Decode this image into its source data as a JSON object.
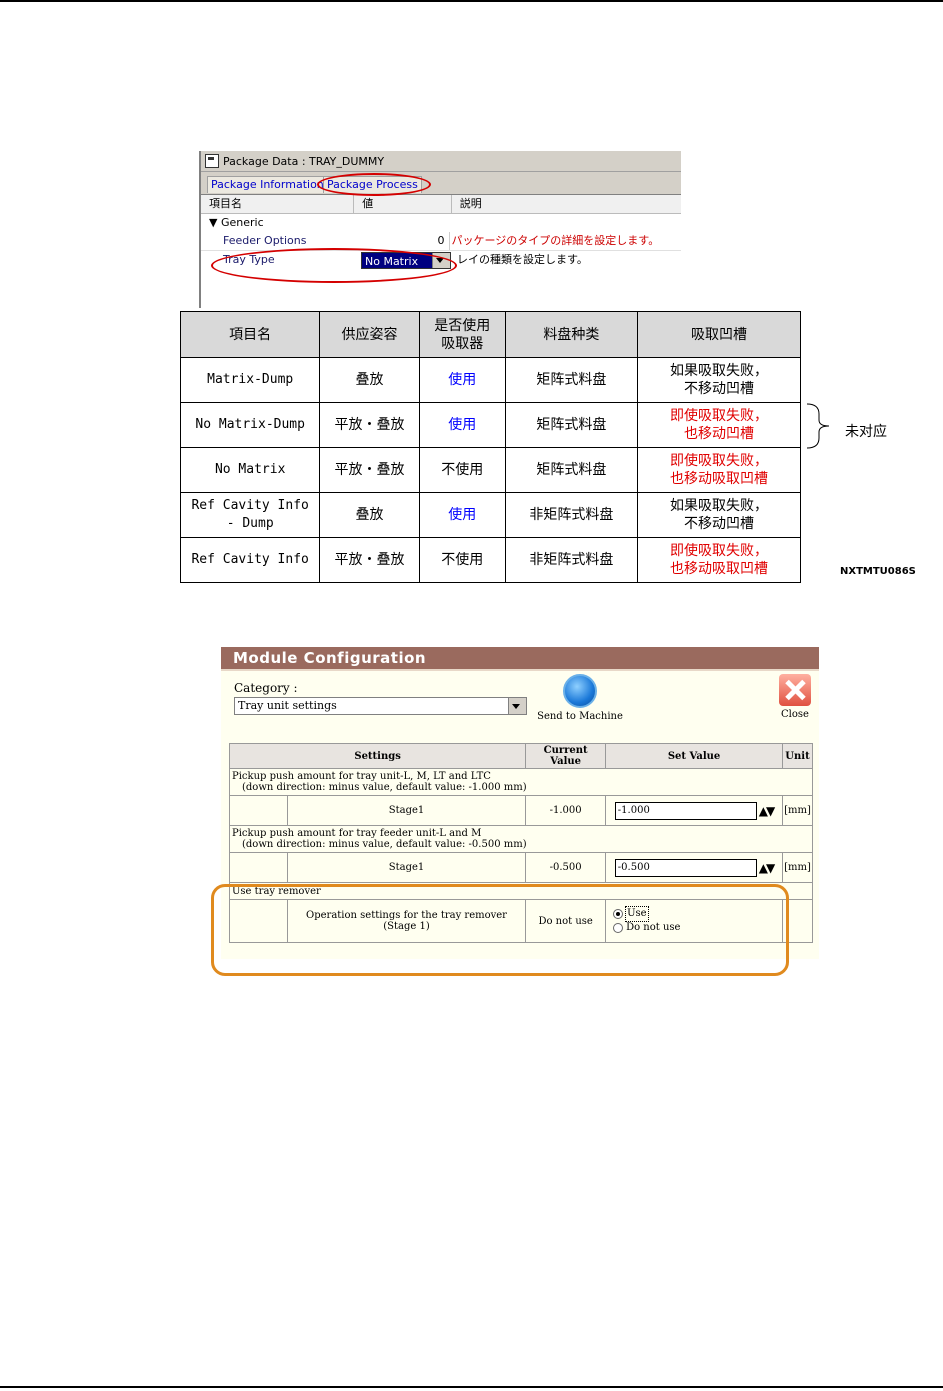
{
  "package_window": {
    "title": "Package Data : TRAY_DUMMY",
    "tabs": [
      "Package Information",
      "Package Process"
    ],
    "columns": [
      "項目名",
      "値",
      "説明"
    ],
    "group": "▼ Generic",
    "rows": [
      {
        "name": "Feeder Options",
        "value": "0",
        "desc": "パッケージのタイプの詳細を設定します。"
      },
      {
        "name": "Tray Type",
        "value": "No Matrix",
        "desc": "レイの種類を設定します。"
      }
    ]
  },
  "cn_table": {
    "headers": [
      "項目名",
      "供应姿容",
      "是否使用\n吸取器",
      "料盘种类",
      "吸取凹槽"
    ],
    "rows": [
      {
        "name": "Matrix-Dump",
        "supply": "叠放",
        "use": "使用",
        "use_color": "blue",
        "tray": "矩阵式料盘",
        "groove": "如果吸取失败，\n不移动凹槽",
        "groove_color": "black"
      },
      {
        "name": "No Matrix-Dump",
        "supply": "平放・叠放",
        "use": "使用",
        "use_color": "blue",
        "tray": "矩阵式料盘",
        "groove": "即使吸取失败，\n也移动凹槽",
        "groove_color": "red"
      },
      {
        "name": "No Matrix",
        "supply": "平放・叠放",
        "use": "不使用",
        "use_color": "black",
        "tray": "矩阵式料盘",
        "groove": "即使吸取失败，\n也移动吸取凹槽",
        "groove_color": "red"
      },
      {
        "name": "Ref Cavity Info\n- Dump",
        "supply": "叠放",
        "use": "使用",
        "use_color": "blue",
        "tray": "非矩阵式料盘",
        "groove": "如果吸取失败，\n不移动凹槽",
        "groove_color": "black"
      },
      {
        "name": "Ref Cavity Info",
        "supply": "平放・叠放",
        "use": "不使用",
        "use_color": "black",
        "tray": "非矩阵式料盘",
        "groove": "即使吸取失败，\n也移动吸取凹槽",
        "groove_color": "red"
      }
    ],
    "side_label": "未对应",
    "figure_code": "NXTMTU086S"
  },
  "module_config": {
    "title": "Module Configuration",
    "category_label": "Category :",
    "category_value": "Tray unit settings",
    "send_label": "Send to Machine",
    "close_label": "Close",
    "headers": [
      "Settings",
      "Current Value",
      "Set Value",
      "Unit"
    ],
    "groups": [
      {
        "desc_line1": "Pickup push amount for tray unit-L, M, LT and LTC",
        "desc_line2": "(down direction: minus value, default value: -1.000 mm)",
        "stage": "Stage1",
        "current": "-1.000",
        "set": "-1.000",
        "unit": "[mm]"
      },
      {
        "desc_line1": "Pickup push amount for tray feeder unit-L and M",
        "desc_line2": "(down direction: minus value, default value: -0.500 mm)",
        "stage": "Stage1",
        "current": "-0.500",
        "set": "-0.500",
        "unit": "[mm]"
      }
    ],
    "remover": {
      "desc": "Use tray remover",
      "setting": "Operation settings for the tray remover (Stage 1)",
      "current": "Do not use",
      "options": [
        "Use",
        "Do not use"
      ]
    }
  },
  "colors": {
    "highlight_red": "#d40000",
    "highlight_orange": "#e08a1e",
    "title_bar": "#9a6a5e"
  }
}
